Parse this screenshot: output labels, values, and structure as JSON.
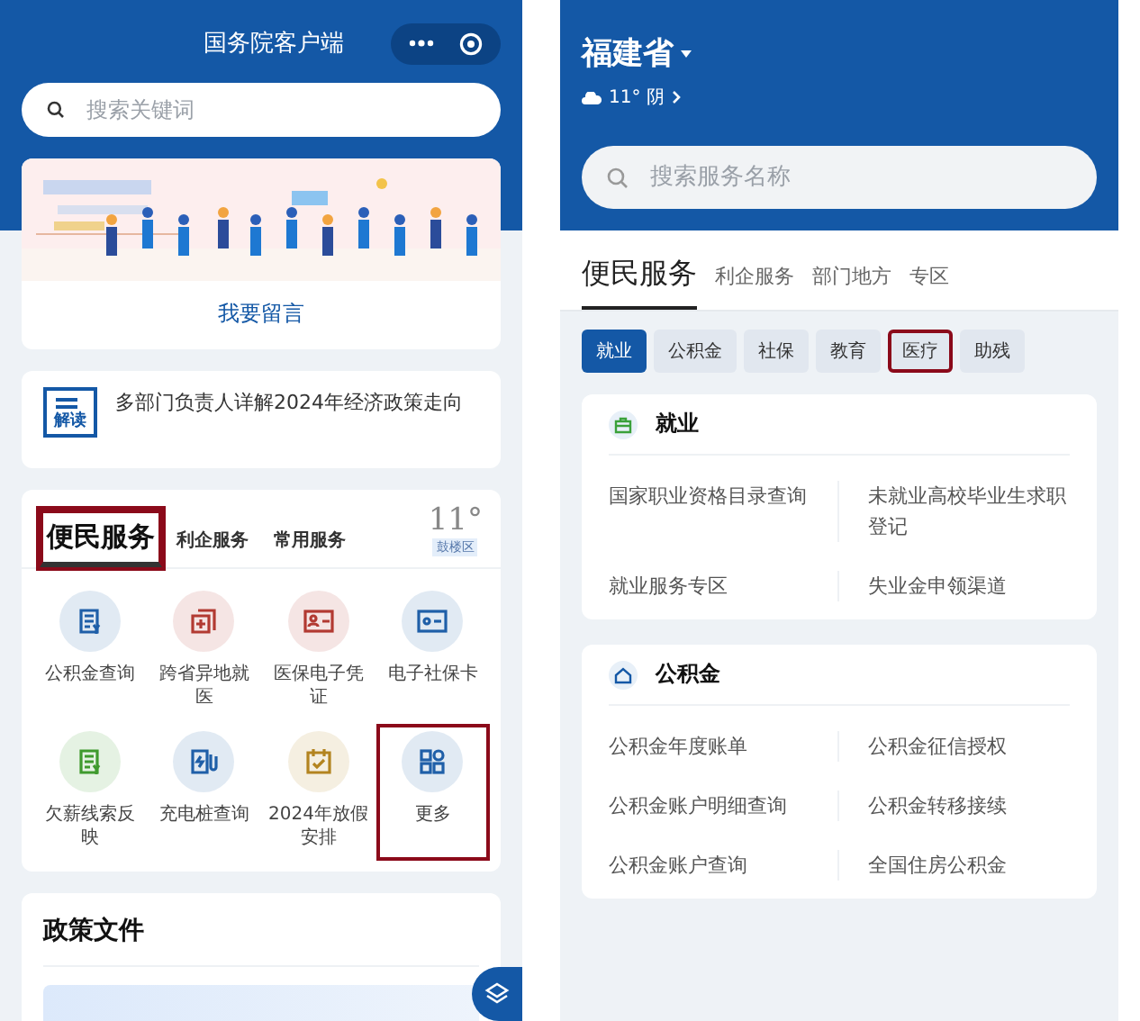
{
  "left": {
    "title": "国务院客户端",
    "search": {
      "placeholder": "搜索关键词"
    },
    "banner": {
      "kind": "picture",
      "action": "我要留言"
    },
    "news": {
      "badge": "解读",
      "text": "多部门负责人详解2024年经济政策走向"
    },
    "services": {
      "tabs": [
        {
          "label": "便民服务",
          "selected": true,
          "highlighted": true
        },
        {
          "label": "利企服务",
          "selected": false,
          "highlighted": false
        },
        {
          "label": "常用服务",
          "selected": false,
          "highlighted": false
        }
      ],
      "weather": {
        "temp": "11°",
        "district": "鼓楼区"
      },
      "items": [
        {
          "label": "公积金查询",
          "kind": "bill",
          "color": "#1f5fa8",
          "highlighted": false
        },
        {
          "label": "跨省异地就医",
          "kind": "medical",
          "color": "#b23a32",
          "highlighted": false
        },
        {
          "label": "医保电子凭证",
          "kind": "idcard",
          "color": "#b23a32",
          "highlighted": false
        },
        {
          "label": "电子社保卡",
          "kind": "card",
          "color": "#1f5fa8",
          "highlighted": false
        },
        {
          "label": "欠薪线索反映",
          "kind": "bill",
          "color": "#3f9a2e",
          "highlighted": false
        },
        {
          "label": "充电桩查询",
          "kind": "charger",
          "color": "#1f5fa8",
          "highlighted": false
        },
        {
          "label": "2024年放假安排",
          "kind": "calendar",
          "color": "#b38420",
          "highlighted": false
        },
        {
          "label": "更多",
          "kind": "grid",
          "color": "#1f5fa8",
          "highlighted": true
        }
      ]
    },
    "policy": {
      "title": "政策文件"
    }
  },
  "right": {
    "province": "福建省",
    "weather": "11° 阴",
    "search": {
      "placeholder": "搜索服务名称"
    },
    "tabs": [
      {
        "label": "便民服务",
        "selected": true
      },
      {
        "label": "利企服务",
        "selected": false
      },
      {
        "label": "部门地方",
        "selected": false
      },
      {
        "label": "专区",
        "selected": false
      }
    ],
    "chips": [
      {
        "label": "就业",
        "selected": true,
        "highlighted": false
      },
      {
        "label": "公积金",
        "selected": false,
        "highlighted": false
      },
      {
        "label": "社保",
        "selected": false,
        "highlighted": false
      },
      {
        "label": "教育",
        "selected": false,
        "highlighted": false
      },
      {
        "label": "医疗",
        "selected": false,
        "highlighted": true
      },
      {
        "label": "助残",
        "selected": false,
        "highlighted": false
      }
    ],
    "sections": [
      {
        "title": "就业",
        "kind": "briefcase",
        "links": [
          "国家职业资格目录查询",
          "未就业高校毕业生求职登记",
          "就业服务专区",
          "失业金申领渠道"
        ]
      },
      {
        "title": "公积金",
        "kind": "house",
        "links": [
          "公积金年度账单",
          "公积金征信授权",
          "公积金账户明细查询",
          "公积金转移接续",
          "公积金账户查询",
          "全国住房公积金"
        ]
      }
    ]
  }
}
